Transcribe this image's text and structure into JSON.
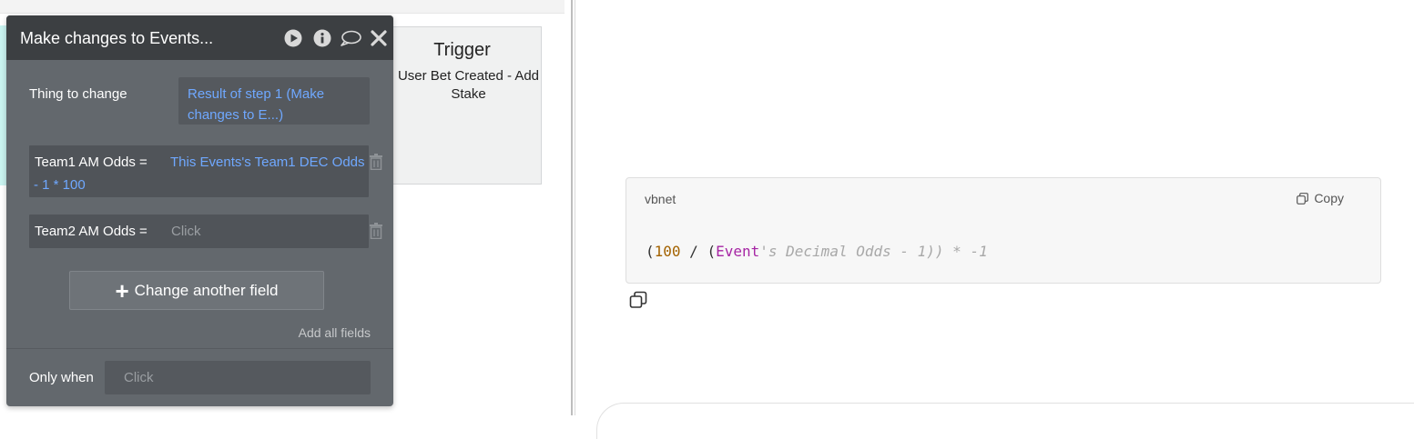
{
  "trigger": {
    "title": "Trigger",
    "subtitle": "User Bet Created - Add Stake"
  },
  "editor": {
    "title": "Make changes to Events...",
    "header_icons": [
      "play-icon",
      "info-icon",
      "comment-icon",
      "close-icon"
    ],
    "thing_to_change": {
      "label": "Thing to change",
      "value": "Result of step 1 (Make changes to E...)"
    },
    "fields": [
      {
        "label": "Team1 AM Odds  =",
        "value_line1": "This Events's Team1 DEC Odds",
        "value_line2": "- 1 * 100"
      },
      {
        "label": "Team2 AM Odds  =",
        "placeholder": "Click"
      }
    ],
    "change_another_label": "Change another field",
    "add_all_label": "Add all fields",
    "only_when": {
      "label": "Only when",
      "placeholder": "Click"
    }
  },
  "code_block": {
    "language": "vbnet",
    "copy_label": "Copy",
    "tokens": {
      "p1": "(",
      "n1": "100",
      "p2": " / (",
      "kw": "Event",
      "str": "'s Decimal Odds - 1)) * -1"
    }
  },
  "colors": {
    "editor_bg": "#63686d",
    "editor_header": "#3c3f42",
    "link_blue": "#6fa8ff",
    "teal_accent": "#c9f3f0"
  }
}
